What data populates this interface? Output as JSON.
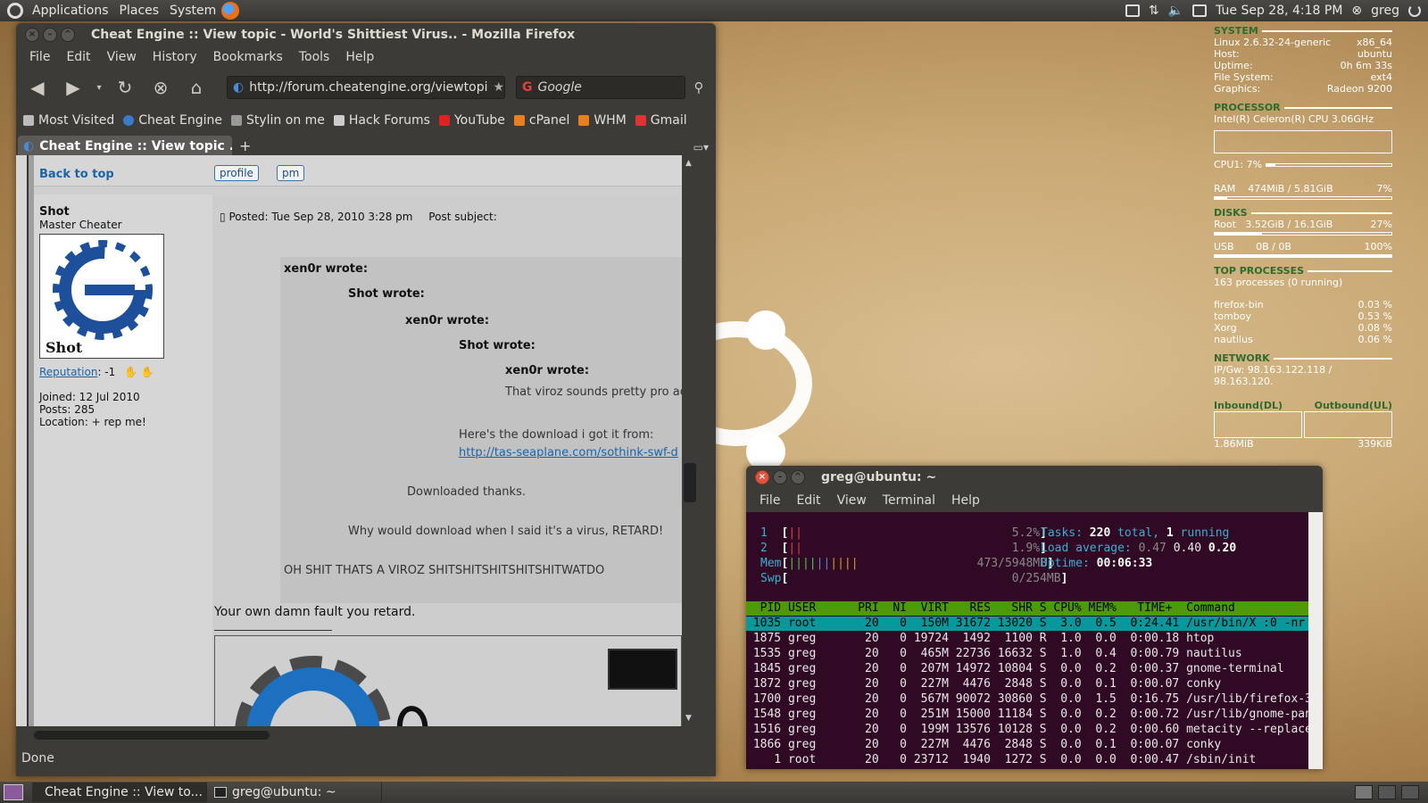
{
  "top_panel": {
    "menus": [
      "Applications",
      "Places",
      "System"
    ],
    "datetime": "Tue Sep 28,  4:18 PM",
    "user": "greg"
  },
  "firefox": {
    "title": "Cheat Engine :: View topic - World's Shittiest Virus.. - Mozilla Firefox",
    "menu": [
      "File",
      "Edit",
      "View",
      "History",
      "Bookmarks",
      "Tools",
      "Help"
    ],
    "url": "http://forum.cheatengine.org/viewtopi",
    "search_placeholder": "Google",
    "bookmarks": [
      "Most Visited",
      "Cheat Engine",
      "Stylin on me",
      "Hack Forums",
      "YouTube",
      "cPanel",
      "WHM",
      "Gmail"
    ],
    "tab_title": "Cheat Engine :: View topic ...",
    "status": "Done",
    "page": {
      "back_to_top": "Back to top",
      "profile_btn": "profile",
      "pm_btn": "pm",
      "username": "Shot",
      "rank": "Master Cheater",
      "avatar_sig": "Shot",
      "reputation_label": "Reputation",
      "reputation_value": ": -1",
      "joined": "Joined: 12 Jul 2010",
      "posts": "Posts: 285",
      "location": "Location: + rep me!",
      "posted": "Posted: Tue Sep 28, 2010 3:28 pm",
      "subject": "Post subject:",
      "quotes": [
        "xen0r wrote:",
        "Shot wrote:",
        "xen0r wrote:",
        "Shot wrote:",
        "xen0r wrote:"
      ],
      "q5_text": "That viroz sounds pretty pro actu",
      "q4_text": "Here's the download i got it from:",
      "q4_link": "http://tas-seaplane.com/sothink-swf-d",
      "q3_text": "Downloaded thanks.",
      "q2_text": "Why would download when I said it's a virus, RETARD!",
      "q1_text": "OH SHIT THATS A VIROZ SHITSHITSHITSHITSHITWATDO",
      "reply": "Your own damn fault you retard."
    }
  },
  "conky": {
    "system_hdr": "SYSTEM",
    "kernel": "Linux 2.6.32-24-generic",
    "arch": "x86_64",
    "host_label": "Host:",
    "host": "ubuntu",
    "uptime_label": "Uptime:",
    "uptime": "0h 6m 33s",
    "fs_label": "File System:",
    "fs": "ext4",
    "gfx_label": "Graphics:",
    "gfx": "Radeon 9200",
    "processor_hdr": "PROCESSOR",
    "cpu_name": "Intel(R) Celeron(R) CPU 3.06GHz",
    "cpu1": "CPU1: 7%",
    "cpu1_fraction": 0.07,
    "ram_label": "RAM",
    "ram": "474MiB / 5.81GiB",
    "ram_pct": "7%",
    "ram_fraction": 0.07,
    "disks_hdr": "DISKS",
    "root_label": "Root",
    "root": "3.52GiB / 16.1GiB",
    "root_pct": "27%",
    "root_fraction": 0.27,
    "usb_label": "USB",
    "usb": "0B  / 0B",
    "usb_pct": "100%",
    "usb_fraction": 1.0,
    "top_hdr": "TOP PROCESSES",
    "proc_count": "163 processes (0 running)",
    "top": [
      {
        "name": "firefox-bin",
        "pct": "0.03 %"
      },
      {
        "name": "tomboy",
        "pct": "0.53 %"
      },
      {
        "name": "Xorg",
        "pct": "0.08 %"
      },
      {
        "name": "nautilus",
        "pct": "0.06 %"
      }
    ],
    "network_hdr": "NETWORK",
    "ip": "IP/Gw: 98.163.122.118 / 98.163.120.",
    "inbound": "Inbound(DL)",
    "outbound": "Outbound(UL)",
    "in_total": "1.86MiB",
    "out_total": "339KiB"
  },
  "terminal": {
    "title": "greg@ubuntu: ~",
    "menu": [
      "File",
      "Edit",
      "View",
      "Terminal",
      "Help"
    ],
    "cpu1": "5.2%",
    "cpu2": "1.9%",
    "mem": "473/5948MB",
    "swp": "0/254MB",
    "tasks_total": "220",
    "tasks_running": "1",
    "load": [
      "0.47",
      "0.40",
      "0.20"
    ],
    "uptime": "00:06:33",
    "header": "  PID USER      PRI  NI  VIRT   RES   SHR S CPU% MEM%   TIME+  Command",
    "rows": [
      " 1035 root       20   0  150M 31672 13020 S  3.0  0.5  0:24.41 /usr/bin/X :0 -nr",
      " 1875 greg       20   0 19724  1492  1100 R  1.0  0.0  0:00.18 htop",
      " 1535 greg       20   0  465M 22736 16632 S  1.0  0.4  0:00.79 nautilus",
      " 1845 greg       20   0  207M 14972 10804 S  0.0  0.2  0:00.37 gnome-terminal",
      " 1872 greg       20   0  227M  4476  2848 S  0.0  0.1  0:00.07 conky",
      " 1700 greg       20   0  567M 90072 30860 S  0.0  1.5  0:16.75 /usr/lib/firefox-3",
      " 1548 greg       20   0  251M 15000 11184 S  0.0  0.2  0:00.72 /usr/lib/gnome-pan",
      " 1516 greg       20   0  199M 13576 10128 S  0.0  0.2  0:00.60 metacity --replace",
      " 1866 greg       20   0  227M  4476  2848 S  0.0  0.1  0:00.07 conky",
      "    1 root       20   0 23712  1940  1272 S  0.0  0.0  0:00.47 /sbin/init"
    ]
  },
  "taskbar": {
    "items": [
      "Cheat Engine :: View to...",
      "greg@ubuntu: ~"
    ]
  }
}
